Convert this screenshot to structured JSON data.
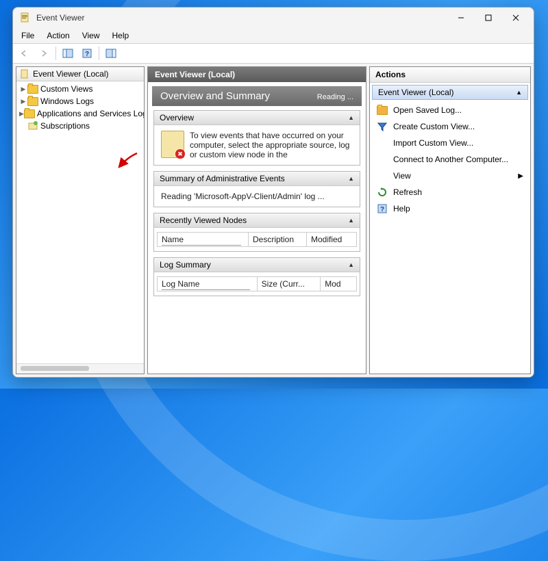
{
  "window": {
    "title": "Event Viewer"
  },
  "menu": {
    "file": "File",
    "action": "Action",
    "view": "View",
    "help": "Help"
  },
  "tree": {
    "root": "Event Viewer (Local)",
    "nodes": {
      "custom_views": "Custom Views",
      "windows_logs": "Windows Logs",
      "app_services": "Applications and Services Logs",
      "subscriptions": "Subscriptions"
    }
  },
  "center": {
    "header": "Event Viewer (Local)",
    "title": "Overview and Summary",
    "reading": "Reading ...",
    "sections": {
      "overview": {
        "label": "Overview",
        "text": "To view events that have occurred on your computer, select the appropriate source, log or custom view node in the"
      },
      "admin": {
        "label": "Summary of Administrative Events",
        "text": "Reading 'Microsoft-AppV-Client/Admin' log ..."
      },
      "recent": {
        "label": "Recently Viewed Nodes",
        "cols": {
          "name": "Name",
          "description": "Description",
          "modified": "Modified"
        }
      },
      "logsum": {
        "label": "Log Summary",
        "cols": {
          "name": "Log Name",
          "size": "Size (Curr...",
          "mod": "Mod"
        }
      }
    }
  },
  "actions": {
    "header": "Actions",
    "context": "Event Viewer (Local)",
    "items": {
      "open_saved": "Open Saved Log...",
      "create_custom": "Create Custom View...",
      "import_custom": "Import Custom View...",
      "connect": "Connect to Another Computer...",
      "view": "View",
      "refresh": "Refresh",
      "help": "Help"
    }
  }
}
